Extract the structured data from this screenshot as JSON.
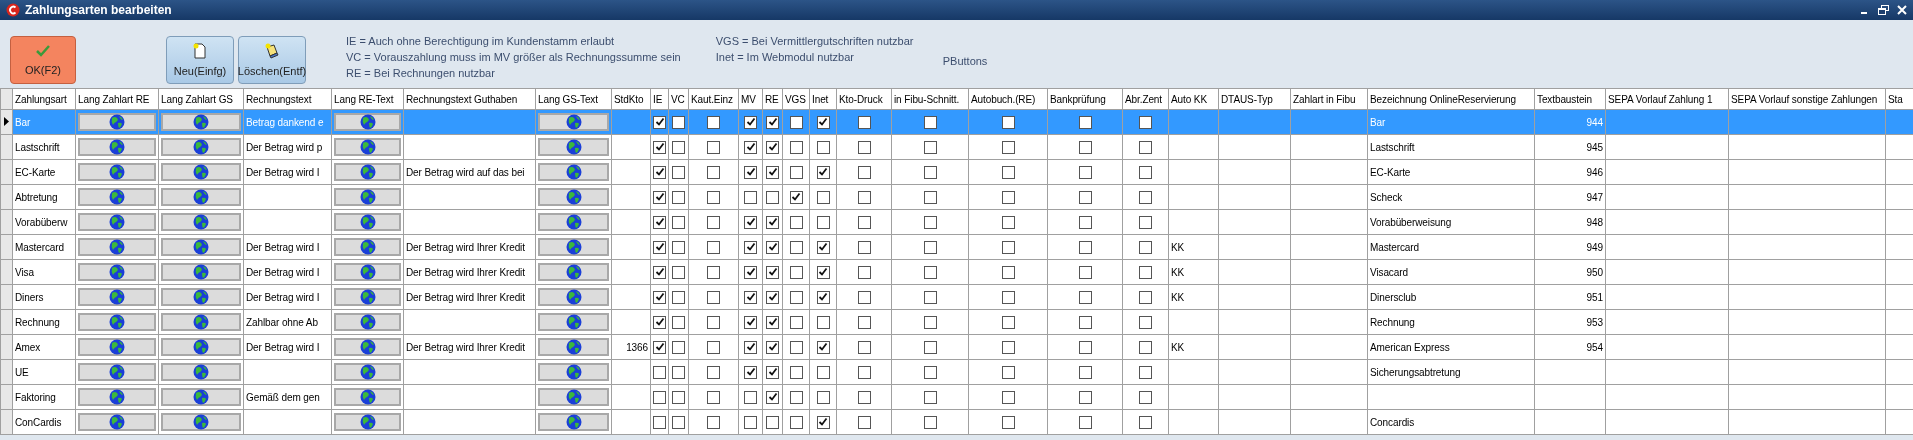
{
  "window": {
    "title": "Zahlungsarten bearbeiten"
  },
  "toolbar": {
    "buttons": [
      {
        "label": "OK(F2)",
        "kind": "ok"
      },
      {
        "label": "Neu(Einfg)",
        "kind": "new"
      },
      {
        "label": "Löschen(Entf)",
        "kind": "delete"
      }
    ],
    "legend": [
      "IE = Auch ohne Berechtigung im Kundenstamm erlaubt",
      "VC = Vorauszahlung muss im MV größer als Rechnungssumme sein",
      "RE = Bei Rechnungen nutzbar",
      "VGS = Bei Vermittlergutschriften nutzbar",
      "Inet = Im Webmodul nutzbar"
    ],
    "caption": "PButtons"
  },
  "table": {
    "columns": [
      {
        "label": "Zahlungsart",
        "kind": "text"
      },
      {
        "label": "Lang Zahlart RE",
        "kind": "globe"
      },
      {
        "label": "Lang Zahlart GS",
        "kind": "globe"
      },
      {
        "label": "Rechnungstext",
        "kind": "text"
      },
      {
        "label": "Lang RE-Text",
        "kind": "globe"
      },
      {
        "label": "Rechnungstext Guthaben",
        "kind": "text"
      },
      {
        "label": "Lang GS-Text",
        "kind": "globe"
      },
      {
        "label": "StdKto",
        "kind": "number"
      },
      {
        "label": "IE",
        "kind": "check"
      },
      {
        "label": "VC",
        "kind": "check"
      },
      {
        "label": "Kaut.Einz",
        "kind": "check"
      },
      {
        "label": "MV",
        "kind": "check"
      },
      {
        "label": "RE",
        "kind": "check"
      },
      {
        "label": "VGS",
        "kind": "check"
      },
      {
        "label": "Inet",
        "kind": "check"
      },
      {
        "label": "Kto-Druck",
        "kind": "check"
      },
      {
        "label": "in Fibu-Schnitt.",
        "kind": "check"
      },
      {
        "label": "Autobuch.(RE)",
        "kind": "check"
      },
      {
        "label": "Bankprüfung",
        "kind": "check"
      },
      {
        "label": "Abr.Zent",
        "kind": "check"
      },
      {
        "label": "Auto KK",
        "kind": "text"
      },
      {
        "label": "DTAUS-Typ",
        "kind": "text"
      },
      {
        "label": "Zahlart in Fibu",
        "kind": "text"
      },
      {
        "label": "Bezeichnung OnlineReservierung",
        "kind": "text"
      },
      {
        "label": "Textbaustein",
        "kind": "number"
      },
      {
        "label": "SEPA Vorlauf Zahlung 1",
        "kind": "text"
      },
      {
        "label": "SEPA Vorlauf sonstige Zahlungen",
        "kind": "text"
      },
      {
        "label": "Sta",
        "kind": "text"
      }
    ],
    "rows": [
      {
        "selected": true,
        "zahlungsart": "Bar",
        "rechnungstext": "Betrag dankend e",
        "checks": [
          true,
          false,
          false,
          true,
          true,
          false,
          true,
          false,
          false,
          false,
          false,
          false
        ],
        "bezeichnung_online": "Bar",
        "textbaustein": "944"
      },
      {
        "selected": false,
        "zahlungsart": "Lastschrift",
        "rechnungstext": "Der Betrag wird p",
        "checks": [
          true,
          false,
          false,
          true,
          true,
          false,
          false,
          false,
          false,
          false,
          false,
          false
        ],
        "bezeichnung_online": "Lastschrift",
        "textbaustein": "945"
      },
      {
        "selected": false,
        "zahlungsart": "EC-Karte",
        "rechnungstext": "Der Betrag wird I",
        "rechnungstext_guthaben": "Der Betrag wird auf das bei",
        "checks": [
          true,
          false,
          false,
          true,
          true,
          false,
          true,
          false,
          false,
          false,
          false,
          false
        ],
        "bezeichnung_online": "EC-Karte",
        "textbaustein": "946"
      },
      {
        "selected": false,
        "zahlungsart": "Abtretung",
        "checks": [
          true,
          false,
          false,
          false,
          false,
          true,
          false,
          false,
          false,
          false,
          false,
          false
        ],
        "bezeichnung_online": "Scheck",
        "textbaustein": "947"
      },
      {
        "selected": false,
        "zahlungsart": "Vorabüberw",
        "checks": [
          true,
          false,
          false,
          true,
          true,
          false,
          false,
          false,
          false,
          false,
          false,
          false
        ],
        "bezeichnung_online": "Vorabüberweisung",
        "textbaustein": "948"
      },
      {
        "selected": false,
        "zahlungsart": "Mastercard",
        "rechnungstext": "Der Betrag wird I",
        "rechnungstext_guthaben": "Der Betrag wird Ihrer Kredit",
        "checks": [
          true,
          false,
          false,
          true,
          true,
          false,
          true,
          false,
          false,
          false,
          false,
          false
        ],
        "auto_kk": "KK",
        "bezeichnung_online": "Mastercard",
        "textbaustein": "949"
      },
      {
        "selected": false,
        "zahlungsart": "Visa",
        "rechnungstext": "Der Betrag wird I",
        "rechnungstext_guthaben": "Der Betrag wird Ihrer Kredit",
        "checks": [
          true,
          false,
          false,
          true,
          true,
          false,
          true,
          false,
          false,
          false,
          false,
          false
        ],
        "auto_kk": "KK",
        "bezeichnung_online": "Visacard",
        "textbaustein": "950"
      },
      {
        "selected": false,
        "zahlungsart": "Diners",
        "rechnungstext": "Der Betrag wird I",
        "rechnungstext_guthaben": "Der Betrag wird Ihrer Kredit",
        "checks": [
          true,
          false,
          false,
          true,
          true,
          false,
          true,
          false,
          false,
          false,
          false,
          false
        ],
        "auto_kk": "KK",
        "bezeichnung_online": "Dinersclub",
        "textbaustein": "951"
      },
      {
        "selected": false,
        "zahlungsart": "Rechnung",
        "rechnungstext": "Zahlbar ohne Ab",
        "checks": [
          true,
          false,
          false,
          true,
          true,
          false,
          false,
          false,
          false,
          false,
          false,
          false
        ],
        "bezeichnung_online": "Rechnung",
        "textbaustein": "953"
      },
      {
        "selected": false,
        "zahlungsart": "Amex",
        "rechnungstext": "Der Betrag wird I",
        "rechnungstext_guthaben": "Der Betrag wird Ihrer Kredit",
        "std_kto": "1366",
        "checks": [
          true,
          false,
          false,
          true,
          true,
          false,
          true,
          false,
          false,
          false,
          false,
          false
        ],
        "auto_kk": "KK",
        "bezeichnung_online": "American Express",
        "textbaustein": "954"
      },
      {
        "selected": false,
        "zahlungsart": "UE",
        "checks": [
          false,
          false,
          false,
          true,
          true,
          false,
          false,
          false,
          false,
          false,
          false,
          false
        ],
        "bezeichnung_online": "Sicherungsabtretung"
      },
      {
        "selected": false,
        "zahlungsart": "Faktoring",
        "rechnungstext": "Gemäß dem gen",
        "checks": [
          false,
          false,
          false,
          false,
          true,
          false,
          false,
          false,
          false,
          false,
          false,
          false
        ]
      },
      {
        "selected": false,
        "zahlungsart": "ConCardis",
        "checks": [
          false,
          false,
          false,
          false,
          false,
          false,
          true,
          false,
          false,
          false,
          false,
          false
        ],
        "bezeichnung_online": "Concardis"
      }
    ]
  }
}
